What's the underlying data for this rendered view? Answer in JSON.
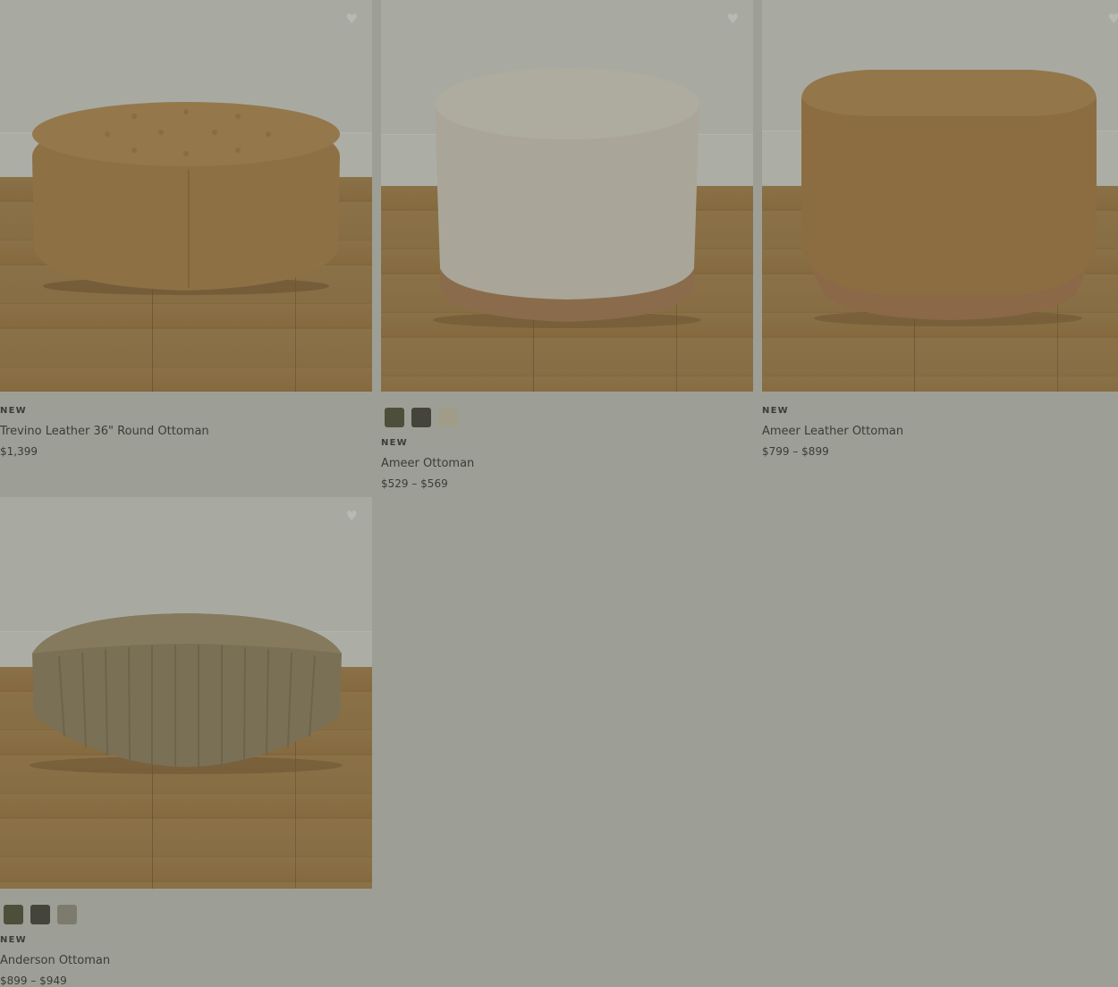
{
  "products": [
    {
      "badge": "NEW",
      "name": "Trevino Leather 36\" Round Ottoman",
      "price": "$1,399",
      "image": "round-tufted-leather-ottoman",
      "swatches": []
    },
    {
      "badge": "NEW",
      "name": "Ameer Ottoman",
      "price": "$529 – $569",
      "image": "round-linen-ottoman-wood-base",
      "swatches": [
        "#4e4f3a",
        "#44443a",
        "#a09c88"
      ]
    },
    {
      "badge": "NEW",
      "name": "Ameer Leather Ottoman",
      "price": "$799 – $899",
      "image": "hexagonal-leather-ottoman",
      "swatches": []
    },
    {
      "badge": "NEW",
      "name": "Anderson Ottoman",
      "price": "$899 – $949",
      "image": "channel-tufted-velvet-ottoman",
      "swatches": [
        "#4e4f3a",
        "#44443a",
        "#7d7b6d"
      ]
    }
  ],
  "icons": {
    "favorite": "heart-icon"
  },
  "colors": {
    "overlay": "#9d9f96",
    "text": "#3b3c38"
  }
}
